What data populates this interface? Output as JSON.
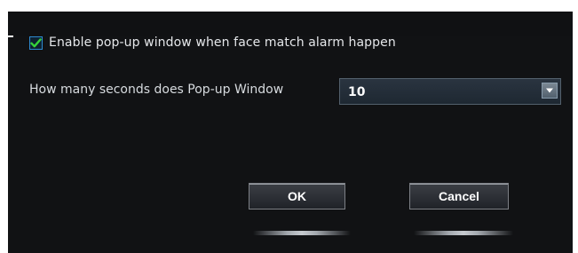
{
  "popup": {
    "enable_checked": true,
    "enable_label": "Enable pop-up window when face match alarm happen",
    "seconds_label": "How many seconds does Pop-up Window",
    "seconds_value": "10"
  },
  "buttons": {
    "ok_label": "OK",
    "cancel_label": "Cancel"
  },
  "icons": {
    "checkmark": "checkmark-icon",
    "dropdown": "chevron-down-icon"
  },
  "colors": {
    "background": "#111214",
    "checkmark": "#36d33a",
    "select_bg": "#24303a",
    "text": "#e5e7ea"
  }
}
